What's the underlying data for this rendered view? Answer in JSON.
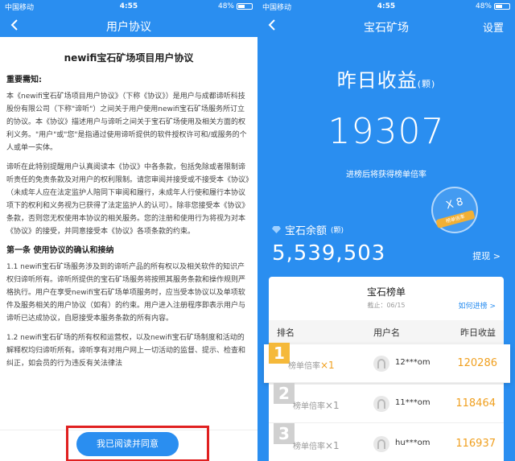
{
  "status_left": {
    "carrier": "中国移动",
    "time": "4:55",
    "battery": "48%"
  },
  "status_right": {
    "carrier": "中国移动",
    "time": "4:55",
    "battery": "48%"
  },
  "agreement": {
    "nav_title": "用户协议",
    "doc_title": "newifi宝石矿场项目用户协议",
    "notice_heading": "重要需知:",
    "para1": "本《newifi宝石矿场项目用户协议》（下称《协议》）是用户与成都谛听科技股份有限公司（下称\"谛听\"）之间关于用户使用newifi宝石矿场服务所订立的协议。本《协议》描述用户与谛听之间关于宝石矿场使用及相关方面的权利义务。\"用户\"或\"您\"是指通过使用谛听提供的软件授权许可和/或服务的个人或单一实体。",
    "para2": "谛听在此特别提醒用户认真阅读本《协议》中各条款，包括免除或者限制谛听责任的免责条款及对用户的权利限制。请您审阅并接受或不接受本《协议》（未成年人应在法定监护人陪同下审阅和履行，未成年人行使和履行本协议项下的权利和义务视为已获得了法定监护人的认可）。除非您接受本《协议》条款，否则您无权使用本协议的相关服务。您的注册和使用行为将视为对本《协议》的接受，并同意接受本《协议》各项条款的约束。",
    "section1_heading": "第一条 使用协议的确认和接纳",
    "para3": "1.1 newifi宝石矿场服务涉及到的谛听产品的所有权以及相关软件的知识产权归谛听所有。谛听所提供的宝石矿场服务将按照其服务条款和操作规则严格执行。用户在享受newifi宝石矿场单项服务时，应当受本协议以及单项软件及服务相关的用户协议（如有）的约束。用户进入注册程序即表示用户与谛听已达成协议，自愿接受本服务条款的所有内容。",
    "para4": "1.2 newifi宝石矿场的所有权和运营权，以及newifi宝石矿场制度和活动的解释权均归谛听所有。谛听享有对用户网上一切活动的监督、提示、检查和纠正，如会员的行为违反有关法律法",
    "agree_button": "我已阅读并同意"
  },
  "mine": {
    "nav_title": "宝石矿场",
    "settings": "设置",
    "yesterday_label": "昨日收益",
    "yesterday_unit": "(颗)",
    "yesterday_value": "19307",
    "caption": "进榜后将获得榜单倍率",
    "badge_x": "X 8",
    "badge_ribbon": "榜单倍率",
    "balance_label": "宝石余额",
    "balance_unit": "(颗)",
    "balance_value": "5,539,503",
    "withdraw": "提现 >",
    "board_title": "宝石榜单",
    "board_date": "截止：06/15",
    "how_to": "如何进榜 >",
    "headers": [
      "排名",
      "用户名",
      "昨日收益"
    ],
    "rows": [
      {
        "rank": "1",
        "mult_label": "榜单倍率",
        "mult": "×1",
        "user": "12***om",
        "income": "120286"
      },
      {
        "rank": "2",
        "mult_label": "榜单倍率",
        "mult": "×1",
        "user": "11***om",
        "income": "118464"
      },
      {
        "rank": "3",
        "mult_label": "榜单倍率",
        "mult": "×1",
        "user": "hu***om",
        "income": "116937"
      }
    ]
  }
}
